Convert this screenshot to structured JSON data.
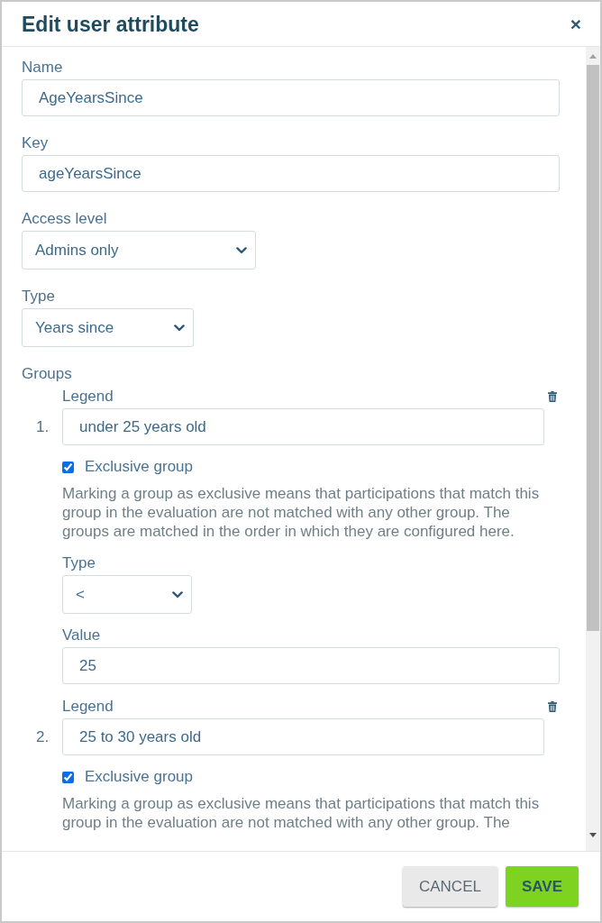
{
  "dialog": {
    "title": "Edit user attribute",
    "close": "×"
  },
  "fields": [
    {
      "kind": "text",
      "label": "Name",
      "value": "AgeYearsSince"
    },
    {
      "kind": "text",
      "label": "Key",
      "value": "ageYearsSince"
    },
    {
      "kind": "select",
      "label": "Access level",
      "value": "Admins only"
    },
    {
      "kind": "select",
      "label": "Type",
      "value": "Years since"
    }
  ],
  "groups": {
    "label": "Groups",
    "items": [
      {
        "number": "1.",
        "legend_label": "Legend",
        "legend": "under 25 years old",
        "exclusive": true,
        "exclusive_label": "Exclusive group",
        "description": "Marking a group as exclusive means that participations that match this group in the evaluation are not matched with any other group. The groups are matched in the order in which they are configured here.",
        "fields": [
          {
            "kind": "select",
            "label": "Type",
            "value": "<"
          },
          {
            "kind": "text",
            "label": "Value",
            "value": "25"
          }
        ]
      },
      {
        "number": "2.",
        "legend_label": "Legend",
        "legend": "25 to 30 years old",
        "exclusive": true,
        "exclusive_label": "Exclusive group",
        "description": "Marking a group as exclusive means that participations that match this group in the evaluation are not matched with any other group. The"
      }
    ]
  },
  "footer": {
    "buttons": [
      {
        "kind": "secondary",
        "label": "CANCEL"
      },
      {
        "kind": "primary",
        "label": "SAVE"
      }
    ]
  }
}
